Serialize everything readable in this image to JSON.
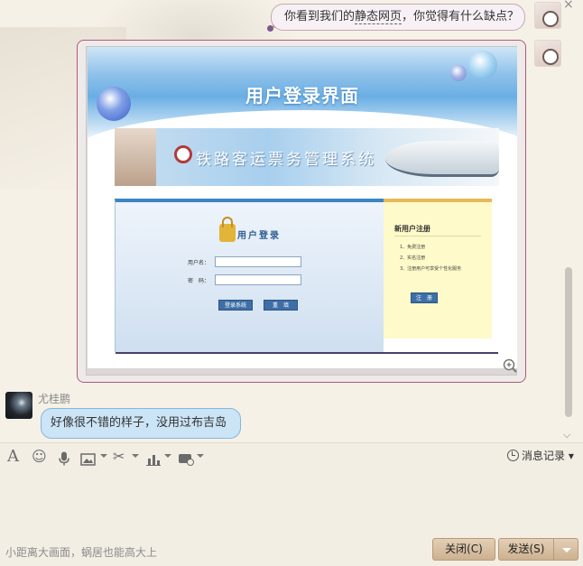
{
  "messages": {
    "sent_text_before": "你看到我们的",
    "sent_link": "静态网页",
    "sent_text_after": "，你觉得有什么缺点？",
    "reply_sender": "尤桂鹏",
    "reply_text": "好像很不错的样子，没用过布吉岛"
  },
  "embedded_page": {
    "title": "用户登录界面",
    "banner_text": "铁路客运票务管理系统",
    "login_title": "用户登录",
    "username_label": "用户名：",
    "password_label": "密　码：",
    "login_button": "登录系统",
    "reset_button": "重　填",
    "register_title": "新用户注册",
    "register_items": [
      "1、免费注册",
      "2、实名注册",
      "3、注册用户可享受个性化服务"
    ],
    "register_button": "注　册"
  },
  "toolbar": {
    "history_label": "消息记录",
    "icons": [
      "font-icon",
      "emoji-icon",
      "mic-icon",
      "image-icon",
      "screenshot-icon",
      "chart-icon",
      "app-icon"
    ]
  },
  "footer": {
    "signature": "小距离大画面，蜗居也能高大上",
    "close_label": "关闭(C)",
    "send_label": "发送(S)"
  },
  "colors": {
    "send_bubble_border": "#c6a7b6",
    "reply_bubble_bg": "#cbe4f6",
    "button_bg": "#d9c2a5"
  }
}
